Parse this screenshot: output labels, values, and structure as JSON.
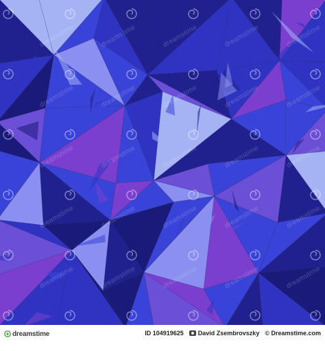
{
  "colors": {
    "deep": "#1a1a7a",
    "navy": "#20208e",
    "royal": "#2f33c2",
    "blue": "#3a43d8",
    "violet": "#6b4fd6",
    "lavender": "#8a8ff0",
    "light": "#a5b3f5",
    "purple": "#7b3fd0",
    "watermark": "#ffffff"
  },
  "watermark": {
    "text": "dreamstime",
    "icon": "dreamstime-swirl-icon"
  },
  "footer": {
    "logo_text": "dreamstime",
    "id_label": "ID 104919625",
    "author_icon": "camera-icon",
    "author": "David Zsembrovszky",
    "copyright": "© Dreamstime.com"
  }
}
